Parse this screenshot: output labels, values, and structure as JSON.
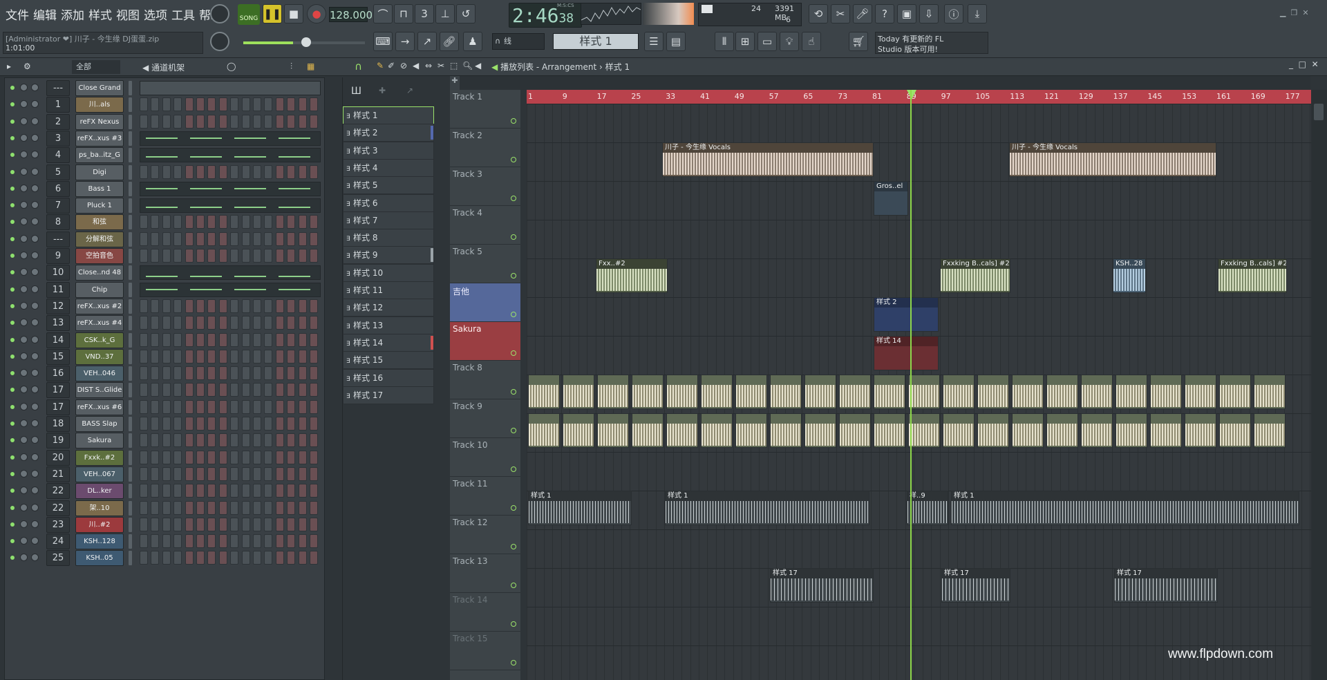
{
  "menu": [
    "文件",
    "编辑",
    "添加",
    "样式",
    "视图",
    "选项",
    "工具",
    "帮助"
  ],
  "transport": {
    "song_label": "SONG",
    "bpm": "128.000",
    "time": "2:46",
    "time_sub": "38",
    "time_unit": "M:S:CS"
  },
  "cpu": {
    "ram": "3391 MB",
    "voices": "24",
    "polyphony": "6"
  },
  "file": {
    "user": "[Administrator ❤",
    "project": "] 川子 - 今生缘 DJ蛋蛋.zip",
    "position": "1:01:00"
  },
  "snap": "线",
  "pattern_selector": "样式 1",
  "news": {
    "line1": "Today  有更新的 FL",
    "line2": "Studio 版本可用!"
  },
  "rack": {
    "filter": "全部",
    "title": "通道机架"
  },
  "playlist": {
    "title": "播放列表 - Arrangement",
    "breadcrumb": "样式 1"
  },
  "channels": [
    {
      "num": "---",
      "name": "Close Grand"
    },
    {
      "num": "1",
      "name": "川..als"
    },
    {
      "num": "2",
      "name": "reFX Nexus"
    },
    {
      "num": "3",
      "name": "reFX..xus #3"
    },
    {
      "num": "4",
      "name": "ps_ba..itz_G"
    },
    {
      "num": "5",
      "name": "Digi"
    },
    {
      "num": "6",
      "name": "Bass 1"
    },
    {
      "num": "7",
      "name": "Pluck 1"
    },
    {
      "num": "8",
      "name": "和弦"
    },
    {
      "num": "---",
      "name": "分解和弦"
    },
    {
      "num": "9",
      "name": "空拍音色"
    },
    {
      "num": "10",
      "name": "Close..nd 48"
    },
    {
      "num": "11",
      "name": "Chip"
    },
    {
      "num": "12",
      "name": "reFX..xus #2"
    },
    {
      "num": "13",
      "name": "reFX..xus #4"
    },
    {
      "num": "14",
      "name": "CSK..k_G"
    },
    {
      "num": "15",
      "name": "VND..37"
    },
    {
      "num": "16",
      "name": "VEH..046"
    },
    {
      "num": "17",
      "name": "DIST S..Glide"
    },
    {
      "num": "17",
      "name": "reFX..xus #6"
    },
    {
      "num": "18",
      "name": "BASS Slap"
    },
    {
      "num": "19",
      "name": "Sakura"
    },
    {
      "num": "20",
      "name": "Fxxk..#2"
    },
    {
      "num": "21",
      "name": "VEH..067"
    },
    {
      "num": "22",
      "name": "DL..ker"
    },
    {
      "num": "22",
      "name": "架..10"
    },
    {
      "num": "23",
      "name": "川..#2"
    },
    {
      "num": "24",
      "name": "KSH..128"
    },
    {
      "num": "25",
      "name": "KSH..05"
    }
  ],
  "patterns": [
    "样式 1",
    "样式 2",
    "样式 3",
    "样式 4",
    "样式 5",
    "样式 6",
    "样式 7",
    "样式 8",
    "样式 9",
    "样式 10",
    "样式 11",
    "样式 12",
    "样式 13",
    "样式 14",
    "样式 15",
    "样式 16",
    "样式 17"
  ],
  "tracks": [
    "Track 1",
    "Track 2",
    "Track 3",
    "Track 4",
    "Track 5",
    "吉他",
    "Sakura",
    "Track 8",
    "Track 9",
    "Track 10",
    "Track 11",
    "Track 12",
    "Track 13",
    "Track 14",
    "Track 15"
  ],
  "ruler": [
    "1",
    "9",
    "17",
    "25",
    "33",
    "41",
    "49",
    "57",
    "65",
    "73",
    "81",
    "89",
    "97",
    "105",
    "113",
    "121",
    "129",
    "137",
    "145",
    "153",
    "161",
    "169",
    "177"
  ],
  "clips": {
    "vocals": "川子 - 今生缘 Vocals",
    "fxx2": "Fxx..#2",
    "fxxking": "Fxxking B..cals] #2",
    "ksh28": "KSH..28",
    "gros": "Gros..el",
    "pat2": "样式 2",
    "pat14": "样式 14",
    "pat1": "样式 1",
    "pat17": "样式 17",
    "pat9": "样..9"
  },
  "watermark": "www.flpdown.com"
}
